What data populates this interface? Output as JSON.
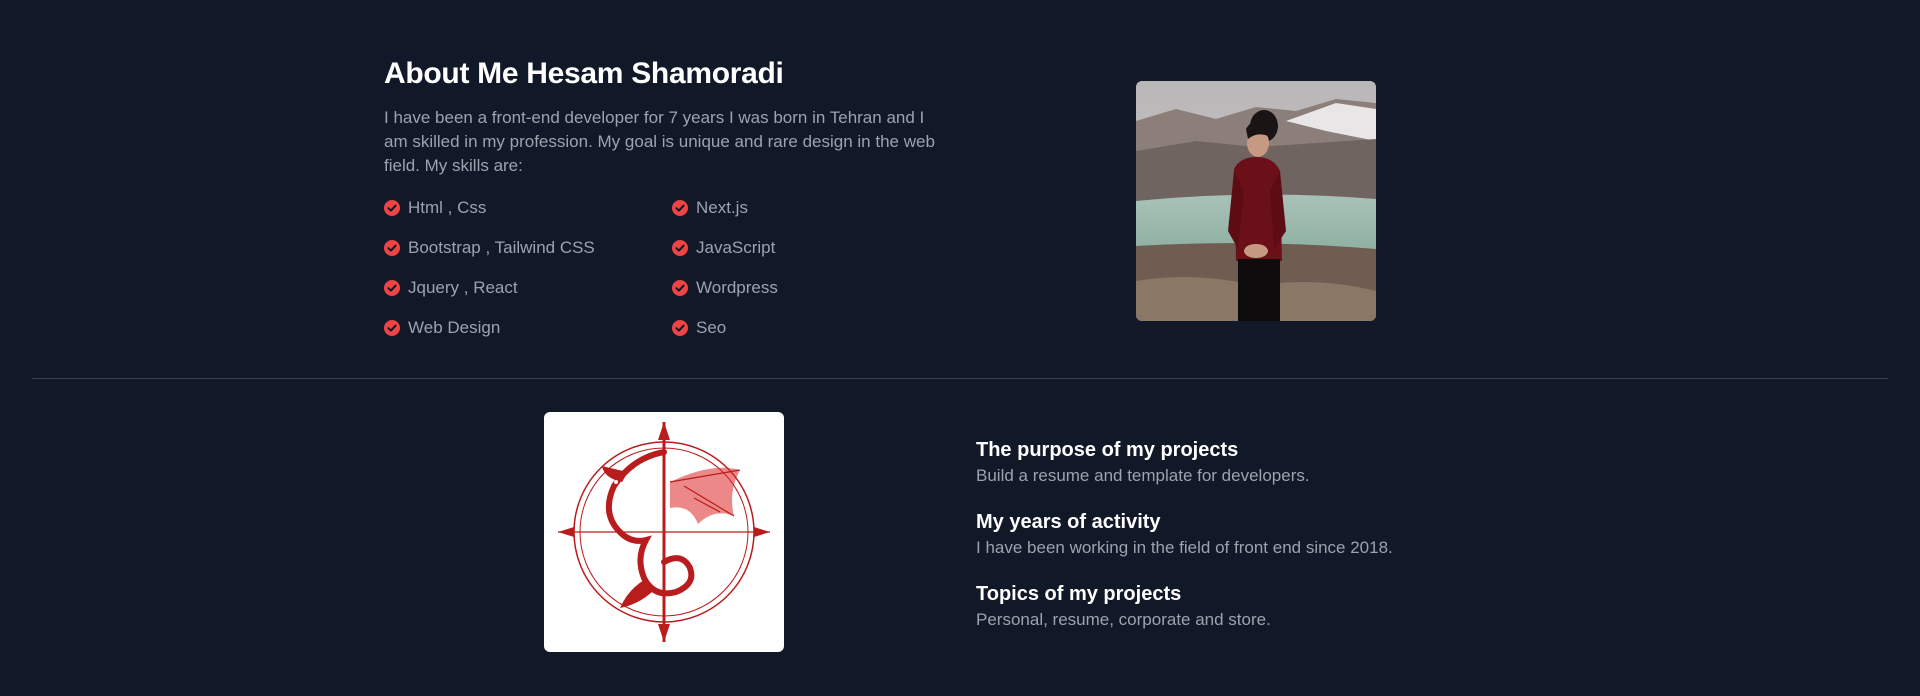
{
  "about": {
    "title": "About Me Hesam Shamoradi",
    "description": "I have been a front-end developer for 7 years I was born in Tehran and I am skilled in my profession. My goal is unique and rare design in the web field. My skills are:",
    "skills": [
      "Html , Css",
      "Next.js",
      "Bootstrap , Tailwind CSS",
      "JavaScript",
      "Jquery , React",
      "Wordpress",
      "Web Design",
      "Seo"
    ],
    "check_icon": "check-circle-icon",
    "accent_color": "#ef4444"
  },
  "features": [
    {
      "title": "The purpose of my projects",
      "description": "Build a resume and template for developers."
    },
    {
      "title": "My years of activity",
      "description": "I have been working in the field of front end since 2018."
    },
    {
      "title": "Topics of my projects",
      "description": "Personal, resume, corporate and store."
    }
  ],
  "colors": {
    "background": "#111827",
    "heading": "#ffffff",
    "text": "#9ca3af",
    "divider": "#374151"
  }
}
